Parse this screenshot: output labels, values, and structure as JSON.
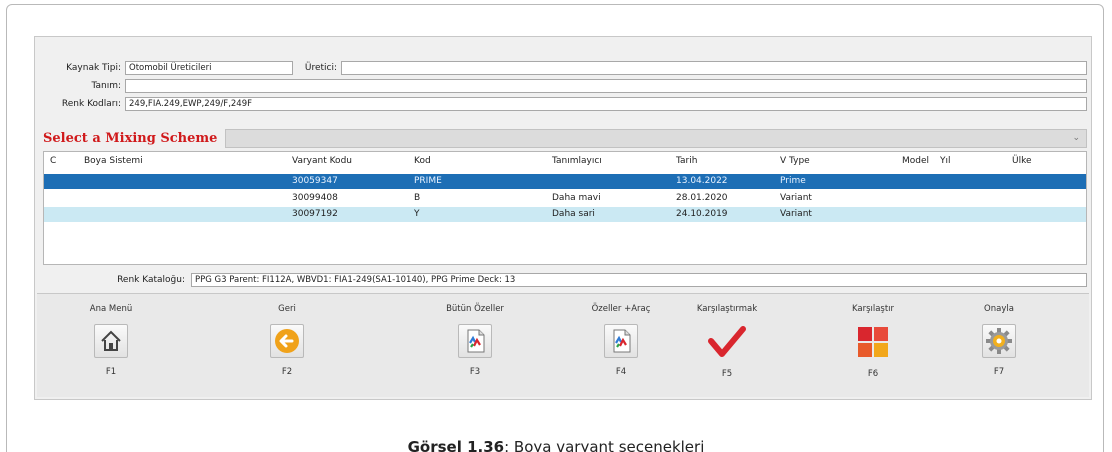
{
  "form": {
    "source_type_label": "Kaynak Tipi:",
    "source_type_value": "Otomobil Üreticileri",
    "manufacturer_label": "Üretici:",
    "manufacturer_value": "",
    "definition_label": "Tanım:",
    "definition_value": "",
    "color_codes_label": "Renk Kodları:",
    "color_codes_value": "249,FIA.249,EWP,249/F,249F"
  },
  "scheme": {
    "title": "Select a Mixing Scheme",
    "selected_value": ""
  },
  "grid": {
    "headers": {
      "c": "C",
      "paint_system": "Boya Sistemi",
      "variant_code": "Varyant Kodu",
      "code": "Kod",
      "identifier": "Tanımlayıcı",
      "date": "Tarih",
      "vtype": "V Type",
      "model": "Model",
      "year": "Yıl",
      "country": "Ülke"
    },
    "rows": [
      {
        "c": "",
        "paint_system": "",
        "variant_code": "30059347",
        "code": "PRIME",
        "identifier": "",
        "date": "13.04.2022",
        "vtype": "Prime"
      },
      {
        "c": "",
        "paint_system": "",
        "variant_code": "30099408",
        "code": "B",
        "identifier": "Daha mavi",
        "date": "28.01.2020",
        "vtype": "Variant"
      },
      {
        "c": "",
        "paint_system": "",
        "variant_code": "30097192",
        "code": "Y",
        "identifier": "Daha sari",
        "date": "24.10.2019",
        "vtype": "Variant"
      }
    ]
  },
  "catalog": {
    "label": "Renk Kataloğu:",
    "value": "PPG G3 Parent: FI112A, WBVD1: FIA1-249(SA1-10140), PPG Prime Deck: 13"
  },
  "toolbar": {
    "buttons": [
      {
        "label": "Ana Menü",
        "key": "F1",
        "icon": "home-icon"
      },
      {
        "label": "Geri",
        "key": "F2",
        "icon": "back-arrow-icon"
      },
      {
        "label": "Bütün Özeller",
        "key": "F3",
        "icon": "document-icon"
      },
      {
        "label": "Özeller +Araç",
        "key": "F4",
        "icon": "document-icon"
      },
      {
        "label": "Karşılaştırmak",
        "key": "F5",
        "icon": "check-icon"
      },
      {
        "label": "Karşılaştır",
        "key": "F6",
        "icon": "tiles-icon"
      },
      {
        "label": "Onayla",
        "key": "F7",
        "icon": "gear-icon"
      }
    ]
  },
  "caption": {
    "prefix": "Görsel 1.36",
    "text": ": Boya varyant seçenekleri"
  },
  "colors": {
    "selected_row": "#1d6eb5",
    "alt_row": "#cbe9f3",
    "scheme_title": "#d0191b",
    "check_red": "#d9262e",
    "back_orange": "#f0a21a"
  }
}
